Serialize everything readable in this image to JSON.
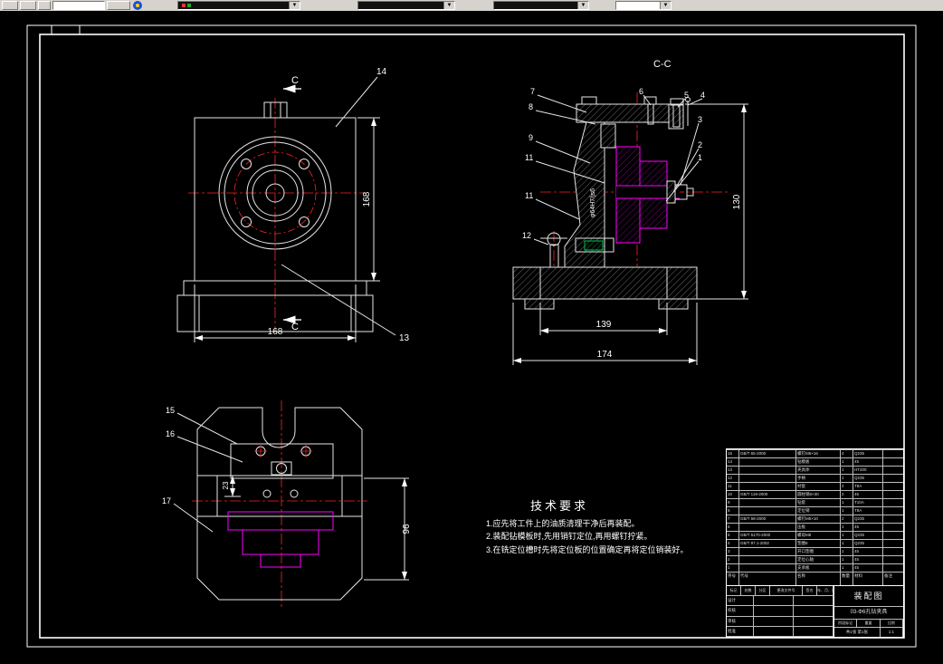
{
  "toolbar": {
    "combos": [
      {
        "label": "layer-combo",
        "value": ""
      },
      {
        "label": "color-combo",
        "value": ""
      },
      {
        "label": "linetype-combo",
        "value": ""
      },
      {
        "label": "lineweight-combo",
        "value": ""
      }
    ],
    "icons": [
      "layers-icon",
      "dropdown-arrow-icon",
      "color-swatch-red",
      "color-swatch-green"
    ],
    "arrow": "▼"
  },
  "colors": {
    "line": "#e6e6e6",
    "frame": "#ffffff",
    "centerline": "#ff2222",
    "aux": "#ff00ff",
    "wedge": "#00b050",
    "background": "#000000",
    "toolbar": "#d6d3ce"
  },
  "front_view": {
    "section_label_top": "C",
    "section_label_bottom": "C",
    "dim_width": "168",
    "dim_height": "168",
    "labels": [
      "14",
      "13"
    ]
  },
  "section_view": {
    "title": "C-C",
    "dims": {
      "d139": "139",
      "d174": "174",
      "d130": "130",
      "fit": "φ64H7/js6"
    },
    "labels": [
      "7",
      "8",
      "9",
      "11",
      "11",
      "12",
      "6",
      "5",
      "4",
      "3",
      "2",
      "1"
    ]
  },
  "top_view": {
    "dims": {
      "d96": "96",
      "d23": "23"
    },
    "labels": [
      "15",
      "16",
      "17"
    ]
  },
  "tech_req": {
    "title": "技术要求",
    "items": [
      "1.应先将工件上的油质清理干净后再装配。",
      "2.装配钻模板时,先用销钉定位,再用螺钉拧紧。",
      "3.在铣定位槽时先将定位板的位置确定再将定位销装好。"
    ]
  },
  "title_block": {
    "bom_header": {
      "no": "序号",
      "code": "代号",
      "name": "名称",
      "qty": "数量",
      "mat": "材料",
      "note": "备注"
    },
    "bom_rows": [
      {
        "no": "15",
        "code": "GB/T 65-2000",
        "name": "螺钉M6×16",
        "qty": "4",
        "mat": "Q235",
        "note": ""
      },
      {
        "no": "14",
        "code": "",
        "name": "钻模板",
        "qty": "1",
        "mat": "45",
        "note": ""
      },
      {
        "no": "13",
        "code": "",
        "name": "夹具体",
        "qty": "1",
        "mat": "HT200",
        "note": ""
      },
      {
        "no": "12",
        "code": "",
        "name": "手柄",
        "qty": "1",
        "mat": "Q235",
        "note": ""
      },
      {
        "no": "11",
        "code": "",
        "name": "衬套",
        "qty": "2",
        "mat": "T8A",
        "note": ""
      },
      {
        "no": "10",
        "code": "GB/T 119-2000",
        "name": "圆柱销6×30",
        "qty": "2",
        "mat": "45",
        "note": ""
      },
      {
        "no": "9",
        "code": "",
        "name": "钻套",
        "qty": "1",
        "mat": "T10A",
        "note": ""
      },
      {
        "no": "8",
        "code": "",
        "name": "定位销",
        "qty": "1",
        "mat": "T8A",
        "note": ""
      },
      {
        "no": "7",
        "code": "GB/T 68-2000",
        "name": "螺钉M5×10",
        "qty": "2",
        "mat": "Q235",
        "note": ""
      },
      {
        "no": "6",
        "code": "",
        "name": "压板",
        "qty": "1",
        "mat": "45",
        "note": ""
      },
      {
        "no": "5",
        "code": "GB/T 6170-2000",
        "name": "螺母M8",
        "qty": "1",
        "mat": "Q235",
        "note": ""
      },
      {
        "no": "4",
        "code": "GB/T 97.1-2002",
        "name": "垫圈8",
        "qty": "1",
        "mat": "Q235",
        "note": ""
      },
      {
        "no": "3",
        "code": "",
        "name": "开口垫圈",
        "qty": "1",
        "mat": "45",
        "note": ""
      },
      {
        "no": "2",
        "code": "",
        "name": "定位心轴",
        "qty": "1",
        "mat": "45",
        "note": ""
      },
      {
        "no": "1",
        "code": "",
        "name": "支承板",
        "qty": "1",
        "mat": "45",
        "note": ""
      }
    ],
    "change_header": [
      "标记",
      "处数",
      "分区",
      "更改文件号",
      "签名",
      "年、月、日"
    ],
    "roles": [
      "设计",
      "校核",
      "审核",
      "批准"
    ],
    "info": {
      "name": "装配图",
      "number": "03-Φ6孔钻夹具",
      "stage_label": "阶段标记",
      "weight_label": "重量",
      "scale_label": "比例",
      "scale": "1:1",
      "sheets": "共1张 第1张"
    }
  }
}
